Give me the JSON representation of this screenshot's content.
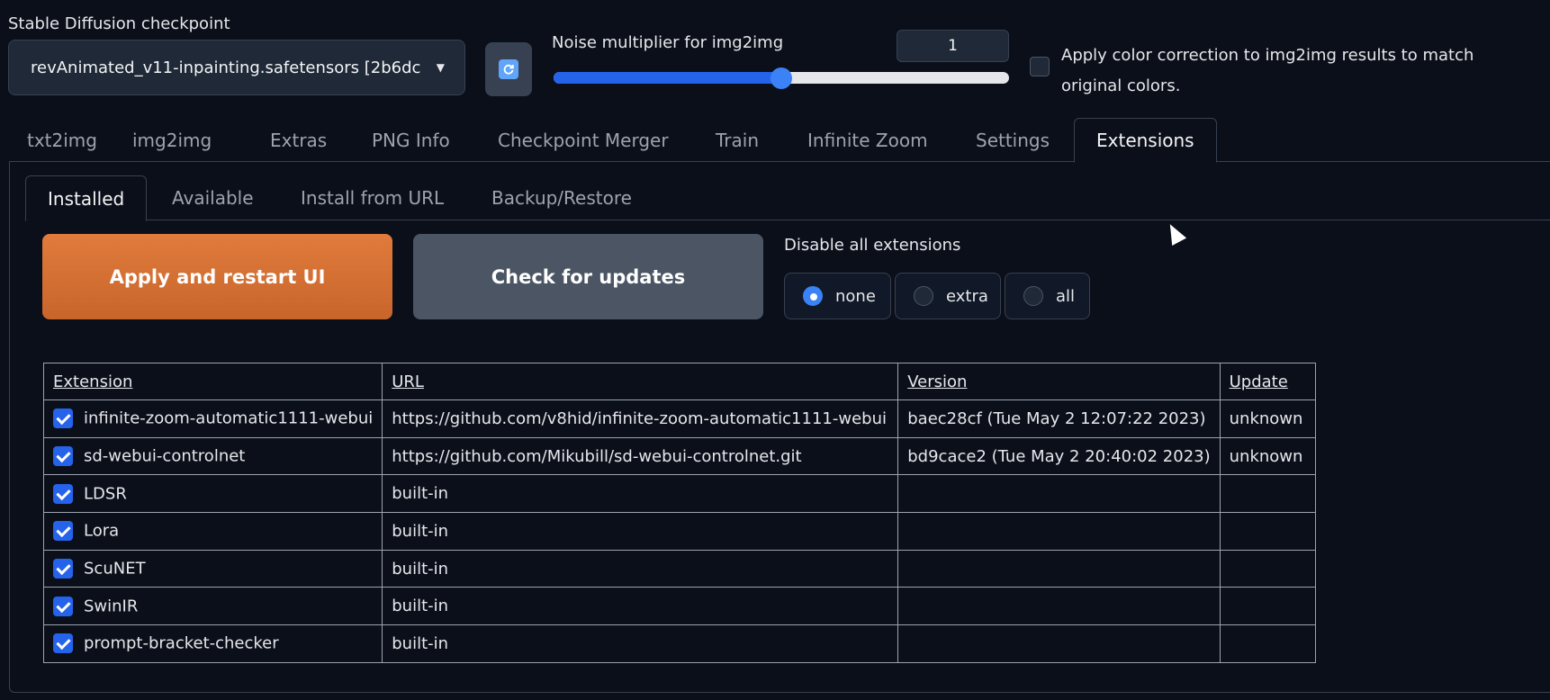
{
  "checkpoint": {
    "label": "Stable Diffusion checkpoint",
    "value": "revAnimated_v11-inpainting.safetensors [2b6dc",
    "refresh_icon": "refresh-icon"
  },
  "noise": {
    "label": "Noise multiplier for img2img",
    "value": "1",
    "fraction": 0.5
  },
  "color_correction": {
    "label": "Apply color correction to img2img results to match original colors.",
    "checked": false
  },
  "main_tabs": {
    "items": [
      "txt2img",
      "img2img",
      "Extras",
      "PNG Info",
      "Checkpoint Merger",
      "Train",
      "Infinite Zoom",
      "Settings",
      "Extensions"
    ],
    "active": "Extensions"
  },
  "sub_tabs": {
    "items": [
      "Installed",
      "Available",
      "Install from URL",
      "Backup/Restore"
    ],
    "active": "Installed"
  },
  "buttons": {
    "apply": "Apply and restart UI",
    "check": "Check for updates"
  },
  "disable": {
    "label": "Disable all extensions",
    "options": [
      "none",
      "extra",
      "all"
    ],
    "selected": "none"
  },
  "table": {
    "headers": [
      "Extension",
      "URL",
      "Version",
      "Update"
    ],
    "rows": [
      {
        "checked": true,
        "name": "infinite-zoom-automatic1111-webui",
        "url": "https://github.com/v8hid/infinite-zoom-automatic1111-webui",
        "version": "baec28cf (Tue May 2 12:07:22 2023)",
        "update": "unknown"
      },
      {
        "checked": true,
        "name": "sd-webui-controlnet",
        "url": "https://github.com/Mikubill/sd-webui-controlnet.git",
        "version": "bd9cace2 (Tue May 2 20:40:02 2023)",
        "update": "unknown"
      },
      {
        "checked": true,
        "name": "LDSR",
        "url": "built-in",
        "version": "",
        "update": ""
      },
      {
        "checked": true,
        "name": "Lora",
        "url": "built-in",
        "version": "",
        "update": ""
      },
      {
        "checked": true,
        "name": "ScuNET",
        "url": "built-in",
        "version": "",
        "update": ""
      },
      {
        "checked": true,
        "name": "SwinIR",
        "url": "built-in",
        "version": "",
        "update": ""
      },
      {
        "checked": true,
        "name": "prompt-bracket-checker",
        "url": "built-in",
        "version": "",
        "update": ""
      }
    ]
  },
  "colors": {
    "accent": "#2563eb",
    "apply_button": "#d9733a",
    "background": "#0b0f19"
  }
}
